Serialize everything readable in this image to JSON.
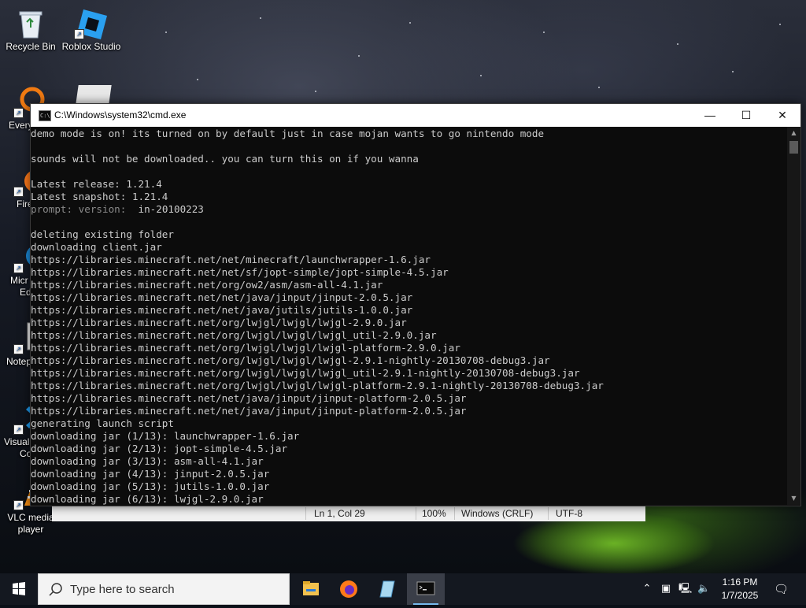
{
  "desktop_icons": [
    {
      "label": "Recycle Bin",
      "icon": "recycle-bin-icon"
    },
    {
      "label": "Roblox Studio",
      "icon": "roblox-studio-icon"
    },
    {
      "label": "Every",
      "icon": "everything-icon"
    },
    {
      "label": "Fire",
      "icon": "firefox-icon"
    },
    {
      "label": "Micr",
      "label2": "Ed",
      "icon": "microsoft-edge-icon"
    },
    {
      "label": "Notep",
      "icon": "notepad-plus-plus-icon"
    },
    {
      "label": "Visual",
      "label2": "Co",
      "icon": "visual-studio-code-icon"
    },
    {
      "label": "VLC media",
      "label2": "player",
      "icon": "vlc-icon"
    }
  ],
  "notepad_status": {
    "position": "Ln 1, Col 29",
    "zoom": "100%",
    "line_endings": "Windows (CRLF)",
    "encoding": "UTF-8"
  },
  "cmd": {
    "title": "C:\\Windows\\system32\\cmd.exe",
    "minimize": "—",
    "maximize": "☐",
    "close": "✕",
    "lines": [
      "demo mode is on! its turned on by default just in case mojan wants to go nintendo mode",
      "",
      "sounds will not be downloaded.. you can turn this on if you wanna",
      "",
      "Latest release: 1.21.4",
      "Latest snapshot: 1.21.4",
      "__PROMPT__",
      "",
      "deleting existing folder",
      "downloading client.jar",
      "https://libraries.minecraft.net/net/minecraft/launchwrapper-1.6.jar",
      "https://libraries.minecraft.net/net/sf/jopt-simple/jopt-simple-4.5.jar",
      "https://libraries.minecraft.net/org/ow2/asm/asm-all-4.1.jar",
      "https://libraries.minecraft.net/net/java/jinput/jinput-2.0.5.jar",
      "https://libraries.minecraft.net/net/java/jutils/jutils-1.0.0.jar",
      "https://libraries.minecraft.net/org/lwjgl/lwjgl/lwjgl-2.9.0.jar",
      "https://libraries.minecraft.net/org/lwjgl/lwjgl/lwjgl_util-2.9.0.jar",
      "https://libraries.minecraft.net/org/lwjgl/lwjgl/lwjgl-platform-2.9.0.jar",
      "https://libraries.minecraft.net/org/lwjgl/lwjgl/lwjgl-2.9.1-nightly-20130708-debug3.jar",
      "https://libraries.minecraft.net/org/lwjgl/lwjgl/lwjgl_util-2.9.1-nightly-20130708-debug3.jar",
      "https://libraries.minecraft.net/org/lwjgl/lwjgl/lwjgl-platform-2.9.1-nightly-20130708-debug3.jar",
      "https://libraries.minecraft.net/net/java/jinput/jinput-platform-2.0.5.jar",
      "https://libraries.minecraft.net/net/java/jinput/jinput-platform-2.0.5.jar",
      "generating launch script",
      "downloading jar (1/13): launchwrapper-1.6.jar",
      "downloading jar (2/13): jopt-simple-4.5.jar",
      "downloading jar (3/13): asm-all-4.1.jar",
      "downloading jar (4/13): jinput-2.0.5.jar",
      "downloading jar (5/13): jutils-1.0.0.jar",
      "downloading jar (6/13): lwjgl-2.9.0.jar"
    ],
    "prompt_label": "prompt: version: ",
    "prompt_value": " in-20100223"
  },
  "taskbar": {
    "search_placeholder": "Type here to search",
    "apps": [
      {
        "name": "file-explorer-icon",
        "active": false
      },
      {
        "name": "firefox-icon",
        "active": false
      },
      {
        "name": "notepad-plus-plus-icon",
        "active": false
      },
      {
        "name": "command-prompt-icon",
        "active": true
      }
    ],
    "time": "1:16 PM",
    "date": "1/7/2025"
  },
  "colors": {
    "cmd_background": "#0c0c0c",
    "cmd_text": "#cccccc",
    "taskbar": "#141820"
  }
}
